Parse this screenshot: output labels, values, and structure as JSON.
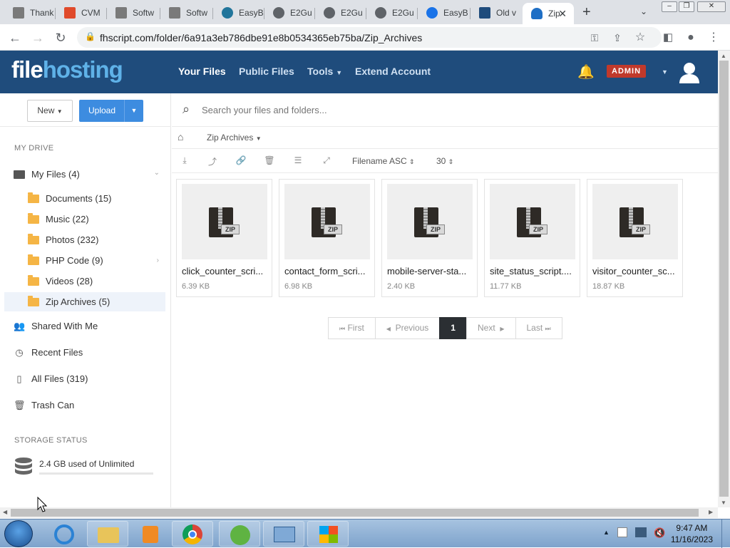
{
  "browser": {
    "tabs": [
      {
        "title": "Thank",
        "color": "#6b6b6b"
      },
      {
        "title": "CVM",
        "color": "#e04a2b"
      },
      {
        "title": "Softw",
        "color": "#6b6b6b"
      },
      {
        "title": "Softw",
        "color": "#6b6b6b"
      },
      {
        "title": "EasyB",
        "color": "#21759b"
      },
      {
        "title": "E2Gu",
        "color": "#5f6368"
      },
      {
        "title": "E2Gu",
        "color": "#5f6368"
      },
      {
        "title": "E2Gu",
        "color": "#5f6368"
      },
      {
        "title": "EasyB",
        "color": "#1a73e8"
      },
      {
        "title": "Old v",
        "color": "#1f4c7c"
      },
      {
        "title": "Zip",
        "color": "#1f6fc5"
      }
    ],
    "url": "fhscript.com/folder/6a91a3eb786dbe91e8b0534365eb75ba/Zip_Archives"
  },
  "header": {
    "logo_part1": "file",
    "logo_part2": "hosting",
    "nav": [
      "Your Files",
      "Public Files",
      "Tools",
      "Extend Account"
    ],
    "admin_label": "ADMIN"
  },
  "sidebar": {
    "new_label": "New",
    "upload_label": "Upload",
    "my_drive_heading": "MY DRIVE",
    "my_files": "My Files (4)",
    "folders": [
      "Documents (15)",
      "Music (22)",
      "Photos (232)",
      "PHP Code (9)",
      "Videos (28)",
      "Zip Archives (5)"
    ],
    "links": [
      "Shared With Me",
      "Recent Files",
      "All Files (319)",
      "Trash Can"
    ],
    "storage_heading": "STORAGE STATUS",
    "storage_text": "2.4 GB used of Unlimited",
    "storage_used_fraction": 0.0
  },
  "main": {
    "search_placeholder": "Search your files and folders...",
    "breadcrumb": "Zip Archives",
    "sort_label": "Filename ASC",
    "per_page": "30",
    "files": [
      {
        "name": "click_counter_scri...",
        "size": "6.39 KB"
      },
      {
        "name": "contact_form_scri...",
        "size": "6.98 KB"
      },
      {
        "name": "mobile-server-sta...",
        "size": "2.40 KB"
      },
      {
        "name": "site_status_script....",
        "size": "11.77 KB"
      },
      {
        "name": "visitor_counter_sc...",
        "size": "18.87 KB"
      }
    ],
    "zip_label": "ZIP",
    "pager": {
      "first": "First",
      "previous": "Previous",
      "current": "1",
      "next": "Next",
      "last": "Last"
    }
  },
  "taskbar": {
    "time": "9:47 AM",
    "date": "11/16/2023"
  }
}
